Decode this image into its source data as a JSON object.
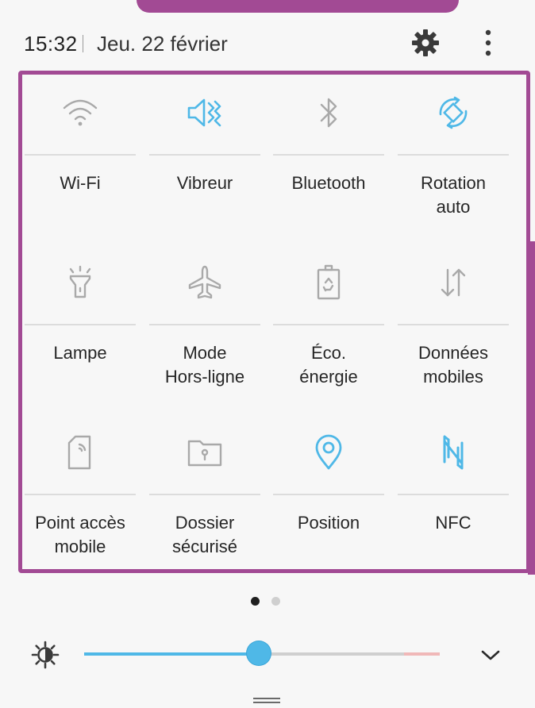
{
  "status_bar": {
    "time": "15:32",
    "date": "Jeu. 22 février"
  },
  "tiles": [
    {
      "label": "Wi-Fi",
      "icon": "wifi-icon",
      "active": false
    },
    {
      "label": "Vibreur",
      "icon": "vibrate-icon",
      "active": true
    },
    {
      "label": "Bluetooth",
      "icon": "bluetooth-icon",
      "active": false
    },
    {
      "label": "Rotation\nauto",
      "icon": "auto-rotate-icon",
      "active": true
    },
    {
      "label": "Lampe",
      "icon": "flashlight-icon",
      "active": false
    },
    {
      "label": "Mode\nHors-ligne",
      "icon": "airplane-icon",
      "active": false
    },
    {
      "label": "Éco.\nénergie",
      "icon": "power-saving-icon",
      "active": false
    },
    {
      "label": "Données\nmobiles",
      "icon": "mobile-data-icon",
      "active": false
    },
    {
      "label": "Point accès\nmobile",
      "icon": "hotspot-icon",
      "active": false
    },
    {
      "label": "Dossier\nsécurisé",
      "icon": "secure-folder-icon",
      "active": false
    },
    {
      "label": "Position",
      "icon": "location-icon",
      "active": true
    },
    {
      "label": "NFC",
      "icon": "nfc-icon",
      "active": true
    }
  ],
  "pagination": {
    "current": 1,
    "total": 2
  },
  "brightness": {
    "level": 0.49
  },
  "colors": {
    "accent": "#4fb8e7",
    "inactive_icon": "#a9a9a9",
    "highlight_frame": "#a24a94"
  }
}
